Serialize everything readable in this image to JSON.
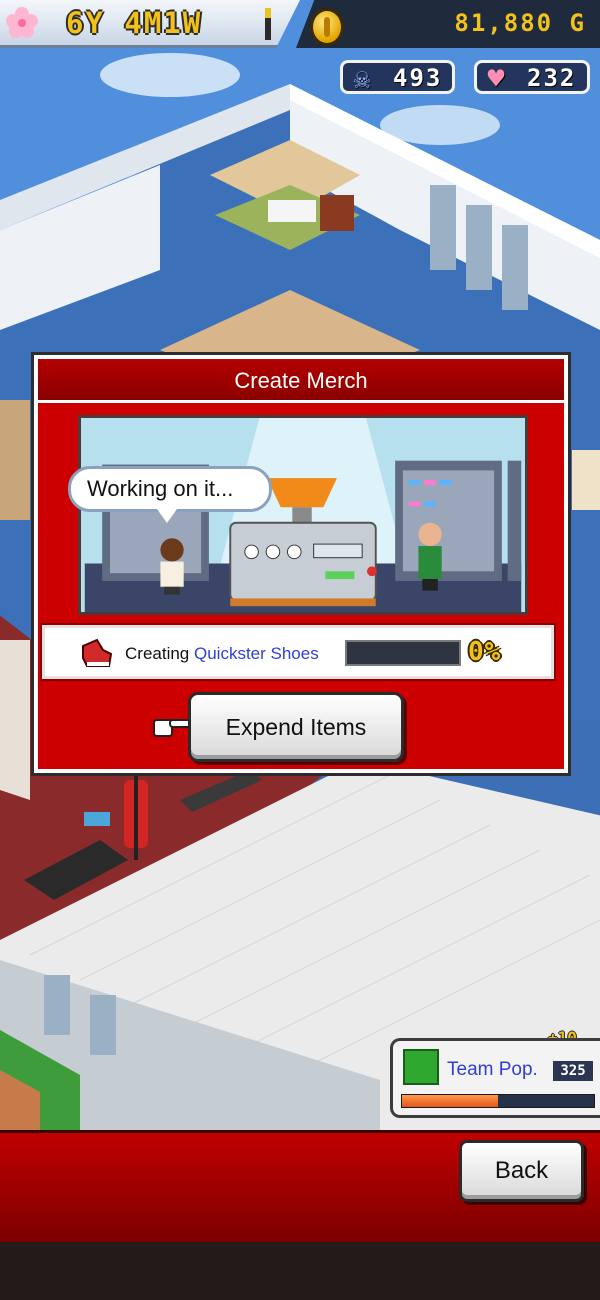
{
  "hud": {
    "date": "6Y 4M1W",
    "money": "81,880 G",
    "staff_count": "493",
    "fans_count": "232"
  },
  "dialog": {
    "title": "Create Merch",
    "speech": "Working on it...",
    "status_prefix": "Creating",
    "product_name": "Quickster Shoes",
    "progress_percent": 0,
    "progress_text": "0%",
    "expend_button_label": "Expend Items"
  },
  "team_pop": {
    "bonus": "+10",
    "label": "Team Pop.",
    "value": "325",
    "fill_fraction": 0.5
  },
  "footer": {
    "back_button_label": "Back"
  },
  "colors": {
    "accent_red": "#cc0000",
    "gold": "#f2c21a",
    "link_blue": "#2f3fd6"
  },
  "icons": {
    "date": "sakura-flower-icon",
    "money": "gold-coin-icon",
    "staff": "skull-icon",
    "fans": "heart-icon",
    "merch": "red-shoe-icon",
    "pointer": "pointing-hand-icon",
    "team_pop": "green-boot-icon"
  }
}
